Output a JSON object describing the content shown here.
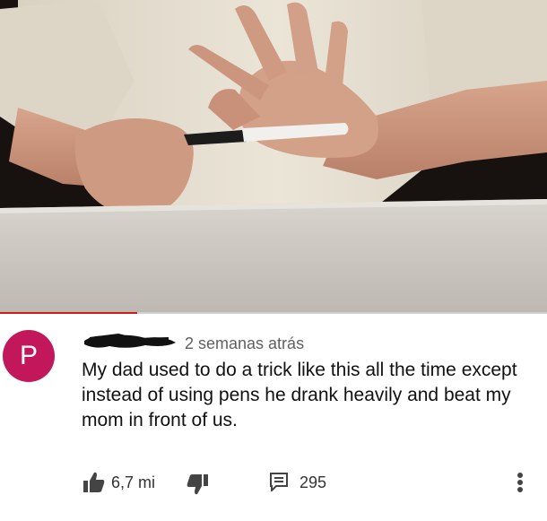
{
  "video": {
    "progress_fraction": 0.25
  },
  "comment": {
    "avatar_letter": "P",
    "avatar_color": "#c2185b",
    "timestamp": "2 semanas atrás",
    "text": "My dad used to do a trick like this all the time except instead of using pens he drank heavily and beat my mom in front of us.",
    "likes": "6,7 mi",
    "replies": "295"
  },
  "icons": {
    "like": "thumbs-up-icon",
    "dislike": "thumbs-down-icon",
    "reply": "comment-icon",
    "more": "vertical-ellipsis-icon"
  },
  "colors": {
    "progress": "#cc1d1d",
    "text": "#111111",
    "meta": "#606060"
  }
}
